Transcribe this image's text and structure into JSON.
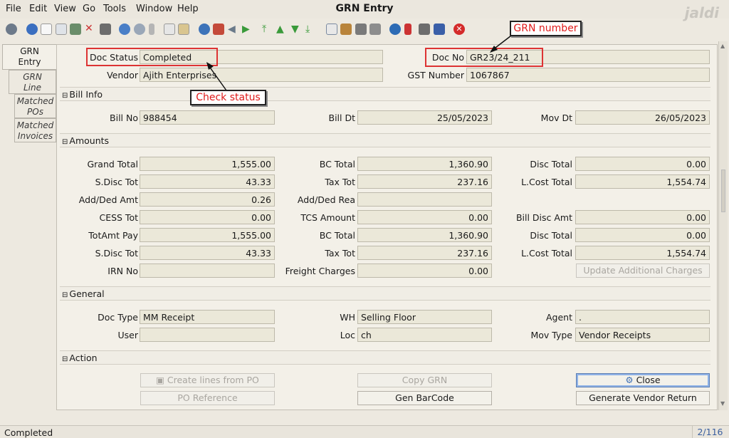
{
  "menu": [
    "File",
    "Edit",
    "View",
    "Go",
    "Tools",
    "Window",
    "Help"
  ],
  "window_title": "GRN Entry",
  "logo_text": "jaldi",
  "side_tabs": {
    "grn_entry": [
      "GRN",
      "Entry"
    ],
    "grn_line": [
      "GRN",
      "Line"
    ],
    "matched_pos": [
      "Matched",
      "POs"
    ],
    "matched_invoices": [
      "Matched",
      "Invoices"
    ]
  },
  "header": {
    "doc_status_label": "Doc Status",
    "doc_status": "Completed",
    "doc_no_label": "Doc No",
    "doc_no": "GR23/24_211",
    "vendor_label": "Vendor",
    "vendor": "Ajith Enterprises",
    "gst_label": "GST Number",
    "gst": "1067867"
  },
  "sections": {
    "bill_info": "Bill Info",
    "amounts": "Amounts",
    "general": "General",
    "action": "Action"
  },
  "bill_info": {
    "bill_no_label": "Bill No",
    "bill_no": "988454",
    "bill_dt_label": "Bill Dt",
    "bill_dt": "25/05/2023",
    "mov_dt_label": "Mov Dt",
    "mov_dt": "26/05/2023"
  },
  "amounts": {
    "grand_total_label": "Grand Total",
    "grand_total": "1,555.00",
    "bc_total_label": "BC Total",
    "bc_total": "1,360.90",
    "disc_total_label": "Disc Total",
    "disc_total": "0.00",
    "sdisc_tot_label": "S.Disc Tot",
    "sdisc_tot": "43.33",
    "tax_tot_label": "Tax Tot",
    "tax_tot": "237.16",
    "lcost_total_label": "L.Cost Total",
    "lcost_total": "1,554.74",
    "add_ded_amt_label": "Add/Ded Amt",
    "add_ded_amt": "0.26",
    "add_ded_rea_label": "Add/Ded Rea",
    "add_ded_rea": "",
    "cess_tot_label": "CESS Tot",
    "cess_tot": "0.00",
    "tcs_amount_label": "TCS Amount",
    "tcs_amount": "0.00",
    "bill_disc_amt_label": "Bill Disc Amt",
    "bill_disc_amt": "0.00",
    "totamt_pay_label": "TotAmt Pay",
    "totamt_pay": "1,555.00",
    "bc_total2_label": "BC Total",
    "bc_total2": "1,360.90",
    "disc_total2_label": "Disc Total",
    "disc_total2": "0.00",
    "sdisc_tot2_label": "S.Disc Tot",
    "sdisc_tot2": "43.33",
    "tax_tot2_label": "Tax Tot",
    "tax_tot2": "237.16",
    "lcost_total2_label": "L.Cost Total",
    "lcost_total2": "1,554.74",
    "irn_no_label": "IRN No",
    "irn_no": "",
    "freight_label": "Freight Charges",
    "freight": "0.00",
    "update_additional_button": "Update Additional Charges"
  },
  "general": {
    "doc_type_label": "Doc Type",
    "doc_type": "MM Receipt",
    "wh_label": "WH",
    "wh": "Selling Floor",
    "agent_label": "Agent",
    "agent": ".",
    "user_label": "User",
    "user": "",
    "loc_label": "Loc",
    "loc": "ch",
    "mov_type_label": "Mov Type",
    "mov_type": "Vendor Receipts"
  },
  "action": {
    "create_lines": "Create lines from PO",
    "copy_grn": "Copy GRN",
    "close": "Close",
    "po_reference": "PO Reference",
    "gen_barcode": "Gen BarCode",
    "generate_vendor_return": "Generate Vendor Return"
  },
  "annotations": {
    "grn_number": "GRN number",
    "check_status": "Check status"
  },
  "status": {
    "text": "Completed",
    "page": "2/116"
  },
  "colors": {
    "callout_red": "#dd3333",
    "background": "#ede9e0",
    "field": "#ebe8d9"
  }
}
